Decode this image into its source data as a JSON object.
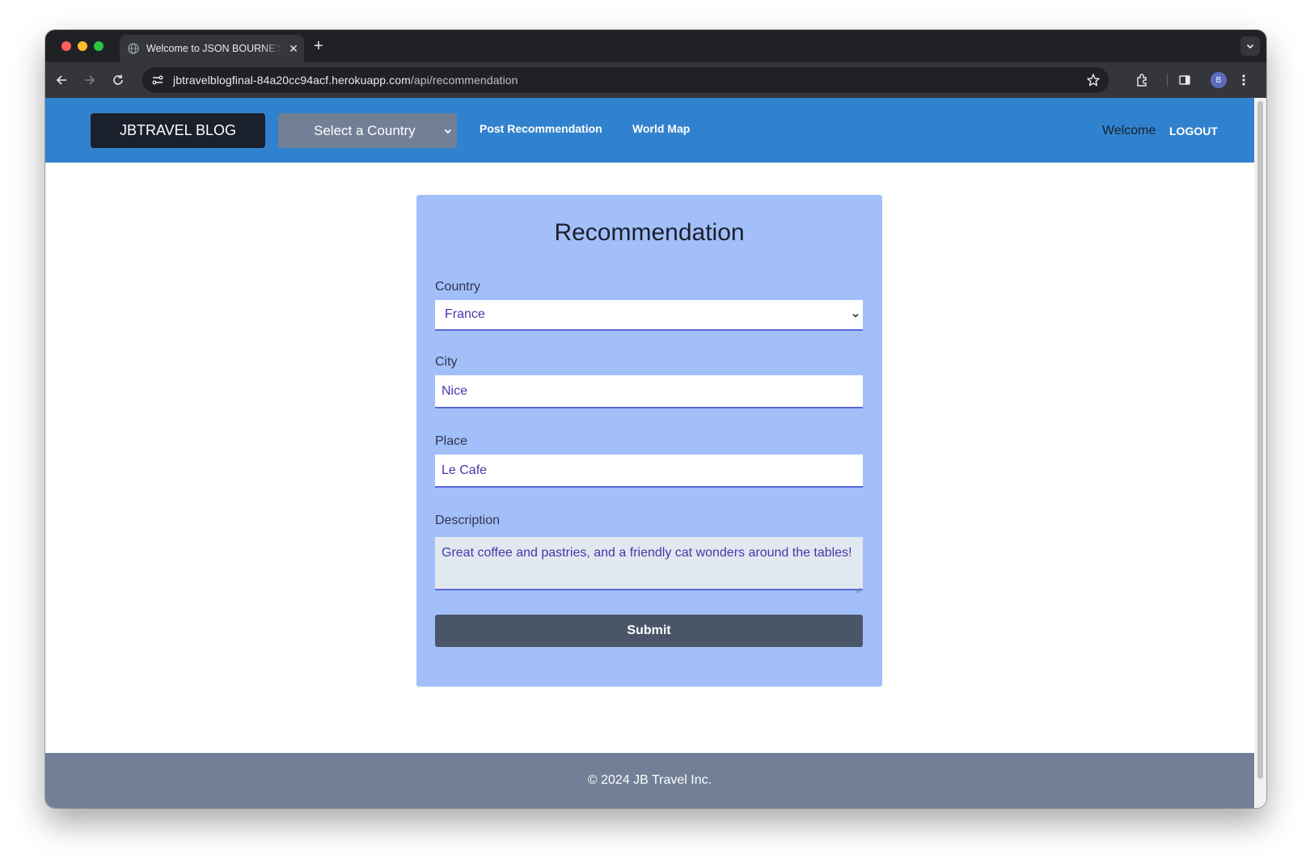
{
  "browser": {
    "tab_title": "Welcome to JSON BOURNE'S",
    "url_host": "jbtravelblogfinal-84a20cc94acf.herokuapp.com",
    "url_path": "/api/recommendation",
    "profile_initial": "B"
  },
  "navbar": {
    "brand": "JBTRAVEL BLOG",
    "country_select": "Select a Country",
    "links": [
      "Post Recommendation",
      "World Map"
    ],
    "welcome": "Welcome",
    "logout": "LOGOUT"
  },
  "form": {
    "title": "Recommendation",
    "country_label": "Country",
    "country_value": "France",
    "city_label": "City",
    "city_value": "Nice",
    "place_label": "Place",
    "place_value": "Le Cafe",
    "description_label": "Description",
    "description_value": "Great coffee and pastries, and a friendly cat wonders around the tables!",
    "submit_label": "Submit"
  },
  "footer": {
    "text": "© 2024 JB Travel Inc."
  },
  "colors": {
    "navbar": "#3182ce",
    "brand_bg": "#1a202c",
    "card_bg": "#a3bffa",
    "submit_bg": "#4a5568",
    "footer_bg": "#718096"
  }
}
